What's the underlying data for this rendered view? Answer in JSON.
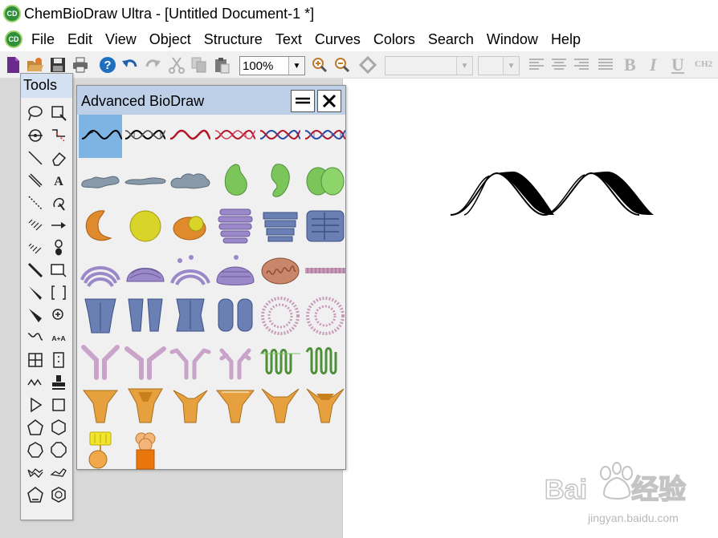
{
  "window": {
    "title": "ChemBioDraw Ultra - [Untitled Document-1 *]",
    "app_icon_label": "CD"
  },
  "menu": {
    "items": [
      "File",
      "Edit",
      "View",
      "Object",
      "Structure",
      "Text",
      "Curves",
      "Colors",
      "Search",
      "Window",
      "Help"
    ]
  },
  "toolbar": {
    "zoom_value": "100%",
    "format_bold": "B",
    "format_italic": "I",
    "format_underline": "U",
    "format_formula": "CH2"
  },
  "tools_palette": {
    "title": "Tools",
    "text_tool_label": "A",
    "text_swap_label": "A+A"
  },
  "biodraw_palette": {
    "title": "Advanced BioDraw",
    "selected_index": 0
  },
  "colors": {
    "title_bar_blue": "#bed0e8",
    "selection_blue": "#7db4e3",
    "green_cell": "#7bc55b",
    "orange_cell": "#e08a2e",
    "purple_cell": "#9a88bf",
    "slate_blue_cell": "#6a7fb4",
    "pink_cell": "#c9a3c9"
  },
  "watermark": {
    "brand": "Baidu经验",
    "url": "jingyan.baidu.com"
  }
}
